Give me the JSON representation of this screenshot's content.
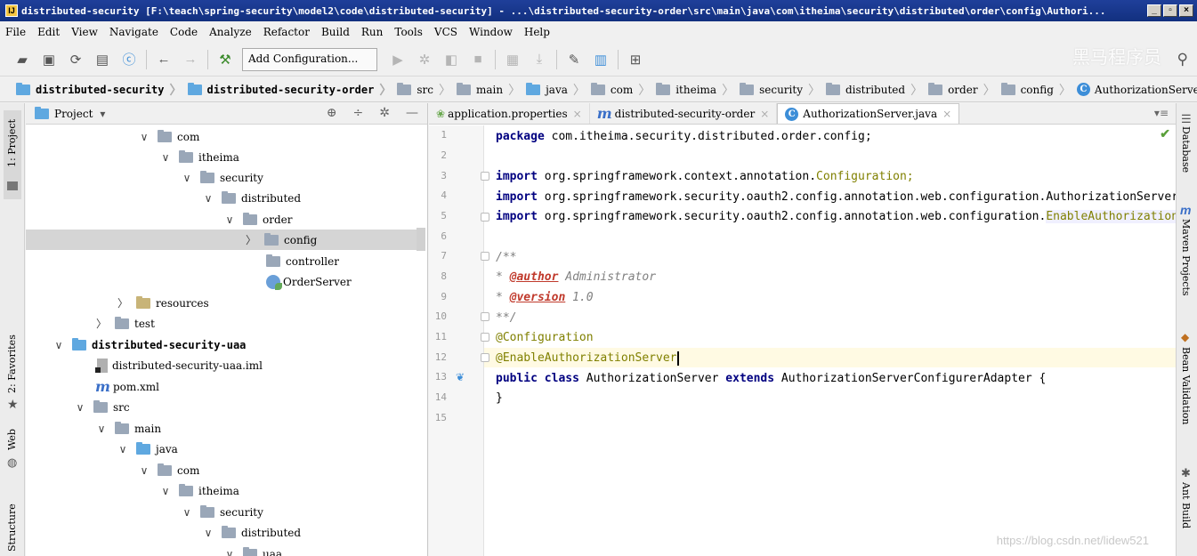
{
  "window": {
    "title": "distributed-security [F:\\teach\\spring-security\\model2\\code\\distributed-security] - ...\\distributed-security-order\\src\\main\\java\\com\\itheima\\security\\distributed\\order\\config\\Authori...",
    "controls": [
      "_",
      "▫",
      "×"
    ]
  },
  "menu": [
    "File",
    "Edit",
    "View",
    "Navigate",
    "Code",
    "Analyze",
    "Refactor",
    "Build",
    "Run",
    "Tools",
    "VCS",
    "Window",
    "Help"
  ],
  "toolbar": {
    "add_configuration": "Add Configuration...",
    "watermark": "黑马程序员"
  },
  "breadcrumb": [
    {
      "label": "distributed-security",
      "bold": true
    },
    {
      "label": "distributed-security-order",
      "bold": true
    },
    {
      "label": "src"
    },
    {
      "label": "main"
    },
    {
      "label": "java"
    },
    {
      "label": "com"
    },
    {
      "label": "itheima"
    },
    {
      "label": "security"
    },
    {
      "label": "distributed"
    },
    {
      "label": "order"
    },
    {
      "label": "config"
    },
    {
      "label": "AuthorizationServer",
      "class": true
    }
  ],
  "left_strip": {
    "project": "1: Project",
    "favorites": "2: Favorites",
    "web": "Web",
    "structure": "Structure"
  },
  "right_strip": {
    "database": "Database",
    "maven": "Maven Projects",
    "bean": "Bean Validation",
    "ant": "Ant Build"
  },
  "project": {
    "header": "Project",
    "rows": [
      {
        "label": "com",
        "arrow": "open"
      },
      {
        "label": "itheima",
        "arrow": "open"
      },
      {
        "label": "security",
        "arrow": "open"
      },
      {
        "label": "distributed",
        "arrow": "open"
      },
      {
        "label": "order",
        "arrow": "open"
      },
      {
        "label": "config",
        "arrow": "closed",
        "selected": true
      },
      {
        "label": "controller"
      },
      {
        "label": "OrderServer"
      },
      {
        "label": "resources",
        "arrow": "closed"
      },
      {
        "label": "test",
        "arrow": "closed"
      },
      {
        "label": "distributed-security-uaa",
        "arrow": "open",
        "bold": true
      },
      {
        "label": "distributed-security-uaa.iml"
      },
      {
        "label": "pom.xml"
      },
      {
        "label": "src",
        "arrow": "open"
      },
      {
        "label": "main",
        "arrow": "open"
      },
      {
        "label": "java",
        "arrow": "open"
      },
      {
        "label": "com",
        "arrow": "open"
      },
      {
        "label": "itheima",
        "arrow": "open"
      },
      {
        "label": "security",
        "arrow": "open"
      },
      {
        "label": "distributed",
        "arrow": "open"
      },
      {
        "label": "uaa",
        "arrow": "open"
      }
    ]
  },
  "tabs": [
    {
      "label": "application.properties"
    },
    {
      "label": "distributed-security-order"
    },
    {
      "label": "AuthorizationServer.java",
      "active": true
    }
  ],
  "code": {
    "line_numbers": [
      "1",
      "2",
      "3",
      "4",
      "5",
      "6",
      "7",
      "8",
      "9",
      "10",
      "11",
      "12",
      "13",
      "14",
      "15"
    ],
    "l1_kw": "package",
    "l1_rest": " com.itheima.security.distributed.order.config;",
    "l3_kw": "import",
    "l3_rest": " org.springframework.context.annotation.",
    "l3_cls": "Configuration",
    "l3_end": ";",
    "l4_kw": "import",
    "l4_rest": " org.springframework.security.oauth2.config.annotation.web.configuration.AuthorizationServerEndpointsConfigurer;",
    "l5_kw": "import",
    "l5_rest": " org.springframework.security.oauth2.config.annotation.web.configuration.",
    "l5_cls": "EnableAuthorizationServer;",
    "l7": "/**",
    "l8_star": " * ",
    "l8_tag": "@author",
    "l8_rest": " Administrator",
    "l9_star": " * ",
    "l9_tag": "@version",
    "l9_rest": " 1.0",
    "l10": " **/",
    "l11": "@Configuration",
    "l12": "@EnableAuthorizationServer",
    "l13_kw1": "public class",
    "l13_mid": " AuthorizationServer ",
    "l13_kw2": "extends",
    "l13_rest": " AuthorizationServerConfigurerAdapter {",
    "l14": "}"
  },
  "footer_watermark": "https://blog.csdn.net/lidew521"
}
